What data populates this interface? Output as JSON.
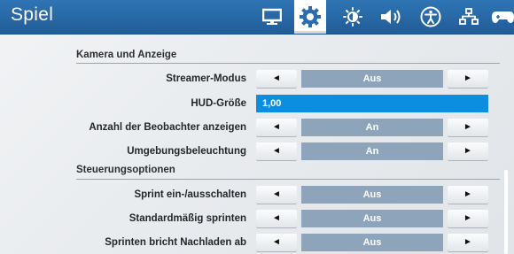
{
  "header": {
    "title": "Spiel",
    "tabs": [
      {
        "name": "monitor-icon",
        "active": false
      },
      {
        "name": "gear-icon",
        "active": true
      },
      {
        "name": "brightness-icon",
        "active": false
      },
      {
        "name": "speaker-icon",
        "active": false
      },
      {
        "name": "accessibility-icon",
        "active": false
      },
      {
        "name": "network-icon",
        "active": false
      },
      {
        "name": "gamepad-icon",
        "active": false
      }
    ]
  },
  "arrows": {
    "left": "◄",
    "right": "►"
  },
  "sections": {
    "camera": {
      "title": "Kamera und Anzeige",
      "rows": [
        {
          "label": "Streamer-Modus",
          "value": "Aus"
        },
        {
          "label": "HUD-Größe",
          "value": "1,00"
        },
        {
          "label": "Anzahl der Beobachter anzeigen",
          "value": "An"
        },
        {
          "label": "Umgebungsbeleuchtung",
          "value": "An"
        }
      ]
    },
    "controls": {
      "title": "Steuerungsoptionen",
      "rows": [
        {
          "label": "Sprint ein-/ausschalten",
          "value": "Aus"
        },
        {
          "label": "Standardmäßig sprinten",
          "value": "Aus"
        },
        {
          "label": "Sprinten bricht Nachladen ab",
          "value": "Aus"
        }
      ]
    }
  },
  "colors": {
    "header_bg": "#2a6aa8",
    "panel_bg": "#e9ecef",
    "value_bg": "#8ea4ba",
    "input_bg": "#0b8de0"
  }
}
